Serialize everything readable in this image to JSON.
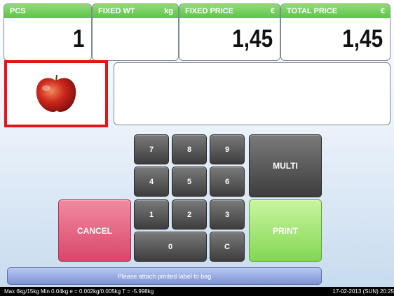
{
  "panels": {
    "pcs": {
      "label": "PCS",
      "unit": "",
      "value": "1"
    },
    "fixed_wt": {
      "label": "FIXED WT",
      "unit": "kg",
      "value": ""
    },
    "fixed_price": {
      "label": "FIXED PRICE",
      "unit": "€",
      "value": "1,45"
    },
    "total_price": {
      "label": "TOTAL PRICE",
      "unit": "€",
      "value": "1,45"
    }
  },
  "product": {
    "image": "apple-icon",
    "info_text": ""
  },
  "keypad": {
    "k7": "7",
    "k8": "8",
    "k9": "9",
    "k4": "4",
    "k5": "5",
    "k6": "6",
    "k1": "1",
    "k2": "2",
    "k3": "3",
    "k0": "0",
    "kc": "C",
    "multi": "MULTI",
    "cancel": "CANCEL",
    "print": "PRINT"
  },
  "message": "Please attach printed label to bag",
  "status_bar": {
    "left": "Max 6kg/15kg  Min 0.04kg  e = 0.002kg/0.005kg  T = -5.998kg",
    "right": "17-02-2013 (SUN)  20:25"
  },
  "colors": {
    "header_green": "#5cc444",
    "cancel": "#d9466b",
    "print": "#83d752",
    "selection_border": "#e3151a"
  }
}
